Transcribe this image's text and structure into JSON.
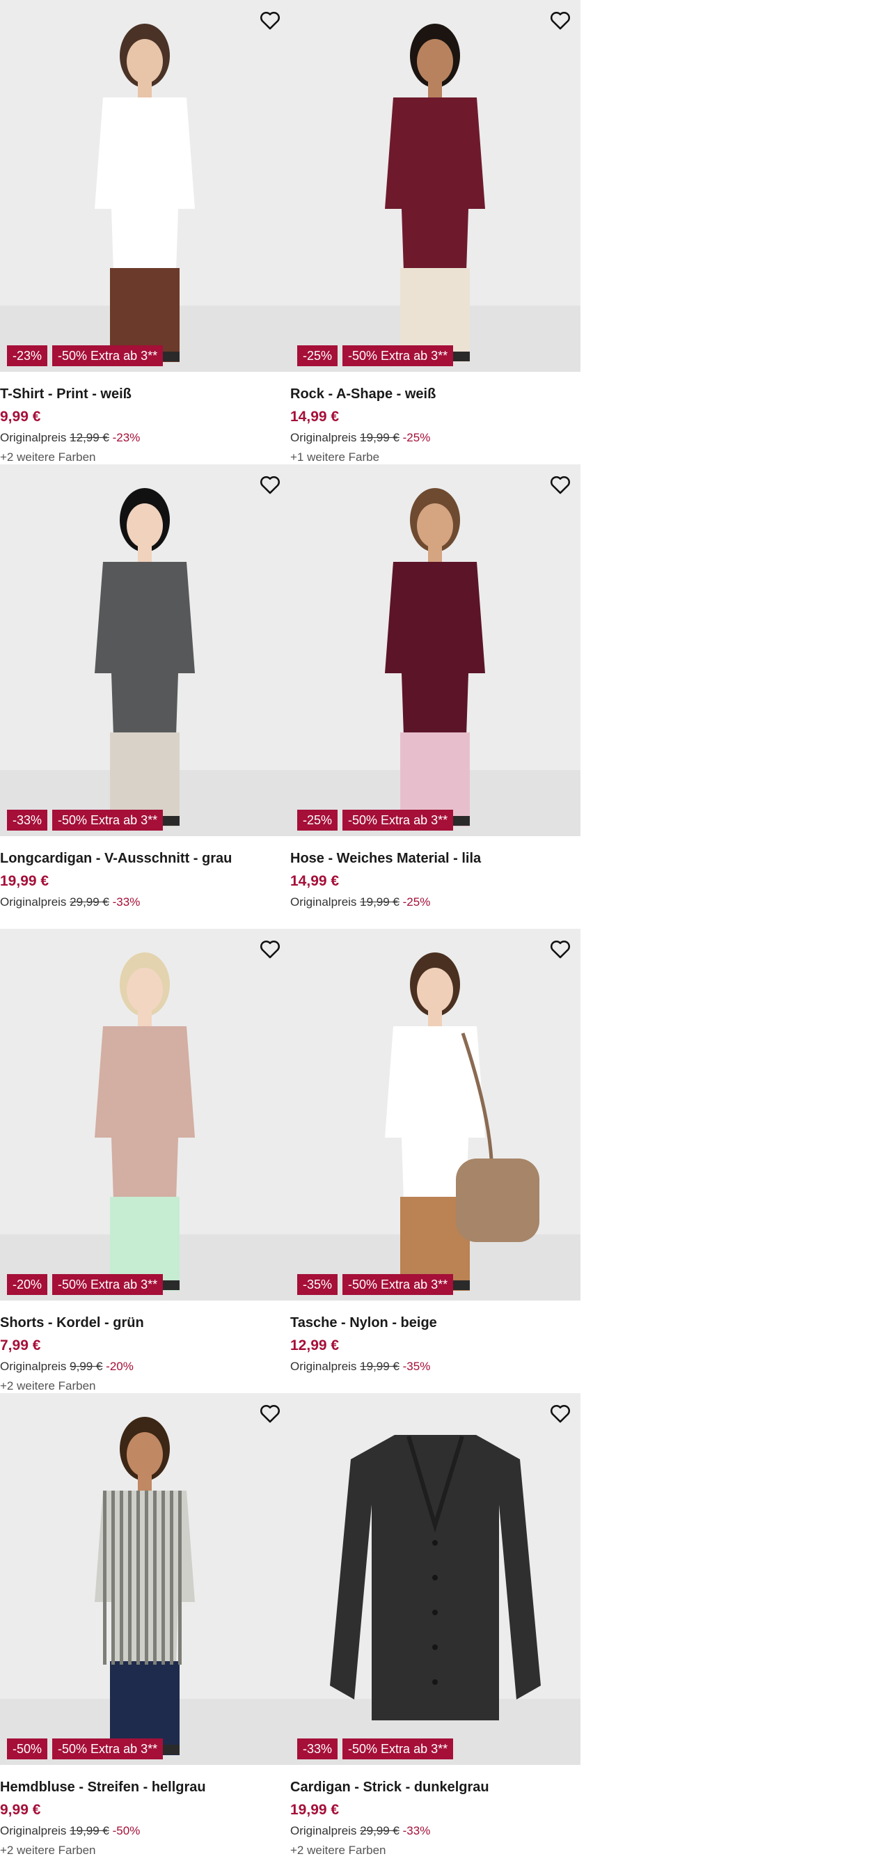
{
  "products": [
    {
      "name": "T-Shirt - Print - weiß",
      "price": "9,99 €",
      "orig_label": "Originalpreis",
      "orig_price": "12,99 €",
      "discount": "-23%",
      "extra": "-50% Extra ab 3**",
      "colors": "+2 weitere Farben",
      "icon": "heart-icon",
      "palette": {
        "top": "#ffffff",
        "bottom": "#6b3a2a",
        "skin": "#e8c4a8",
        "hair": "#4a3226"
      }
    },
    {
      "name": "Rock - A-Shape - weiß",
      "price": "14,99 €",
      "orig_label": "Originalpreis",
      "orig_price": "19,99 €",
      "discount": "-25%",
      "extra": "-50% Extra ab 3**",
      "colors": "+1 weitere Farbe",
      "icon": "heart-icon",
      "palette": {
        "top": "#6e1a2c",
        "bottom": "#ece2d4",
        "skin": "#b8825e",
        "hair": "#1b1410"
      }
    },
    {
      "name": "Longcardigan - V-Ausschnitt - grau",
      "price": "19,99 €",
      "orig_label": "Originalpreis",
      "orig_price": "29,99 €",
      "discount": "-33%",
      "extra": "-50% Extra ab 3**",
      "colors": "",
      "icon": "heart-icon",
      "palette": {
        "top": "#57585a",
        "bottom": "#d9d2c8",
        "skin": "#f0d2bd",
        "hair": "#111111"
      }
    },
    {
      "name": "Hose - Weiches Material - lila",
      "price": "14,99 €",
      "orig_label": "Originalpreis",
      "orig_price": "19,99 €",
      "discount": "-25%",
      "extra": "-50% Extra ab 3**",
      "colors": "",
      "icon": "heart-icon",
      "palette": {
        "top": "#5c1428",
        "bottom": "#e7bfcc",
        "skin": "#d5a481",
        "hair": "#6e4a30"
      }
    },
    {
      "name": "Shorts - Kordel - grün",
      "price": "7,99 €",
      "orig_label": "Originalpreis",
      "orig_price": "9,99 €",
      "discount": "-20%",
      "extra": "-50% Extra ab 3**",
      "colors": "+2 weitere Farben",
      "icon": "heart-icon",
      "palette": {
        "top": "#d3aea2",
        "bottom": "#c6ecd2",
        "skin": "#f2d6c2",
        "hair": "#e3d3ae"
      }
    },
    {
      "name": "Tasche - Nylon - beige",
      "price": "12,99 €",
      "orig_label": "Originalpreis",
      "orig_price": "19,99 €",
      "discount": "-35%",
      "extra": "-50% Extra ab 3**",
      "colors": "",
      "icon": "heart-icon",
      "palette": {
        "top": "#ffffff",
        "bottom": "#bb8253",
        "skin": "#f0cfb8",
        "hair": "#4a3020"
      }
    },
    {
      "name": "Hemdbluse - Streifen - hellgrau",
      "price": "9,99 €",
      "orig_label": "Originalpreis",
      "orig_price": "19,99 €",
      "discount": "-50%",
      "extra": "-50% Extra ab 3**",
      "colors": "+2 weitere Farben",
      "icon": "heart-icon",
      "palette": {
        "top": "#cfd0ca",
        "bottom": "#1f2b4c",
        "skin": "#c08863",
        "hair": "#3c2615"
      }
    },
    {
      "name": "Cardigan - Strick - dunkelgrau",
      "price": "19,99 €",
      "orig_label": "Originalpreis",
      "orig_price": "29,99 €",
      "discount": "-33%",
      "extra": "-50% Extra ab 3**",
      "colors": "+2 weitere Farben",
      "icon": "heart-icon",
      "palette": {
        "top": "#2f2f2f",
        "bottom": "#2f2f2f",
        "skin": "#2f2f2f",
        "hair": "#2f2f2f"
      }
    }
  ]
}
